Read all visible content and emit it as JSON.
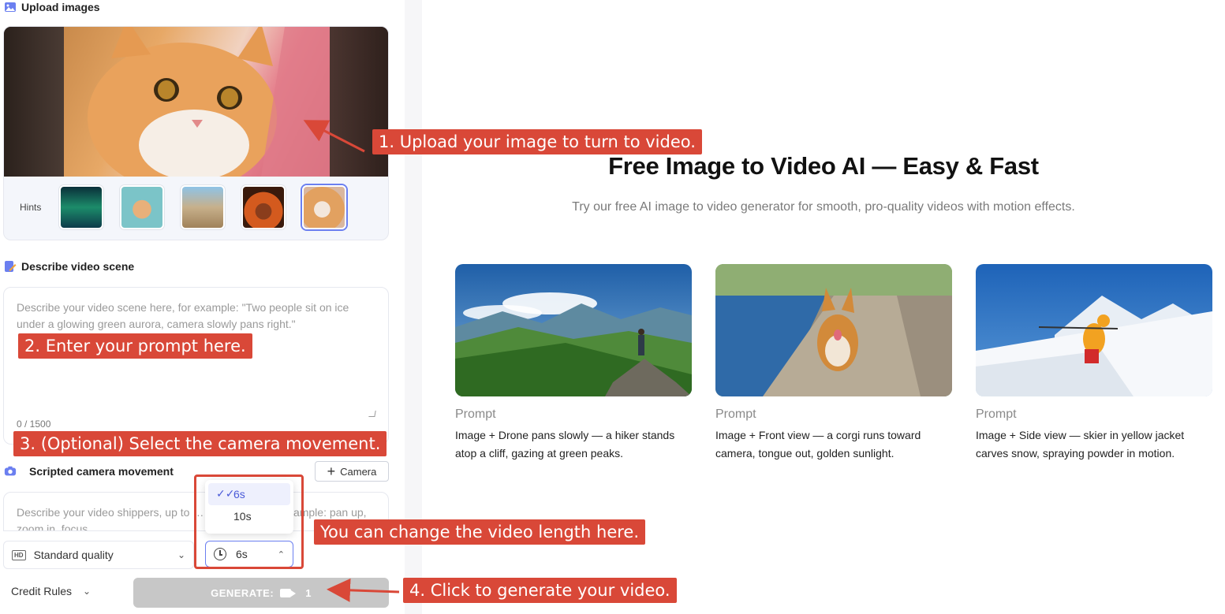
{
  "upload": {
    "title": "Upload images",
    "hints_label": "Hints"
  },
  "describe": {
    "title": "Describe video scene",
    "placeholder": "Describe your video scene here, for example: \"Two people sit on ice under a glowing green aurora, camera slowly pans right.\"",
    "counter": "0 / 1500"
  },
  "camera": {
    "title": "Scripted camera movement",
    "button_label": "Camera",
    "placeholder": "Describe your video shippers, up to … supported. For example: pan up, zoom in, focus…"
  },
  "settings": {
    "quality_label": "Standard quality",
    "quality_badge": "HD",
    "duration_value": "6s",
    "duration_options": [
      "6s",
      "10s"
    ],
    "selected_duration": "6s"
  },
  "footer": {
    "credit_rules": "Credit Rules",
    "generate_label": "GENERATE:",
    "generate_cost": "1"
  },
  "hero": {
    "title": "Free Image to Video AI — Easy & Fast",
    "subtitle": "Try our free AI image to video generator for smooth, pro-quality videos with motion effects."
  },
  "examples": [
    {
      "label": "Prompt",
      "text": "Image + Drone pans slowly — a hiker stands atop a cliff, gazing at green peaks."
    },
    {
      "label": "Prompt",
      "text": "Image + Front view — a corgi runs toward camera, tongue out, golden sunlight."
    },
    {
      "label": "Prompt",
      "text": "Image + Side view — skier in yellow jacket carves snow, spraying powder in motion."
    }
  ],
  "annotations": {
    "a1": "1. Upload your image to turn to video.",
    "a2": "2. Enter your prompt here.",
    "a3": "3. (Optional) Select the camera movement.",
    "a4": "You can change the video length here.",
    "a5": "4. Click to generate your video."
  },
  "colors": {
    "accent": "#6b7ff0",
    "annotation": "#d94838",
    "generate_disabled": "#c7c7c7"
  }
}
